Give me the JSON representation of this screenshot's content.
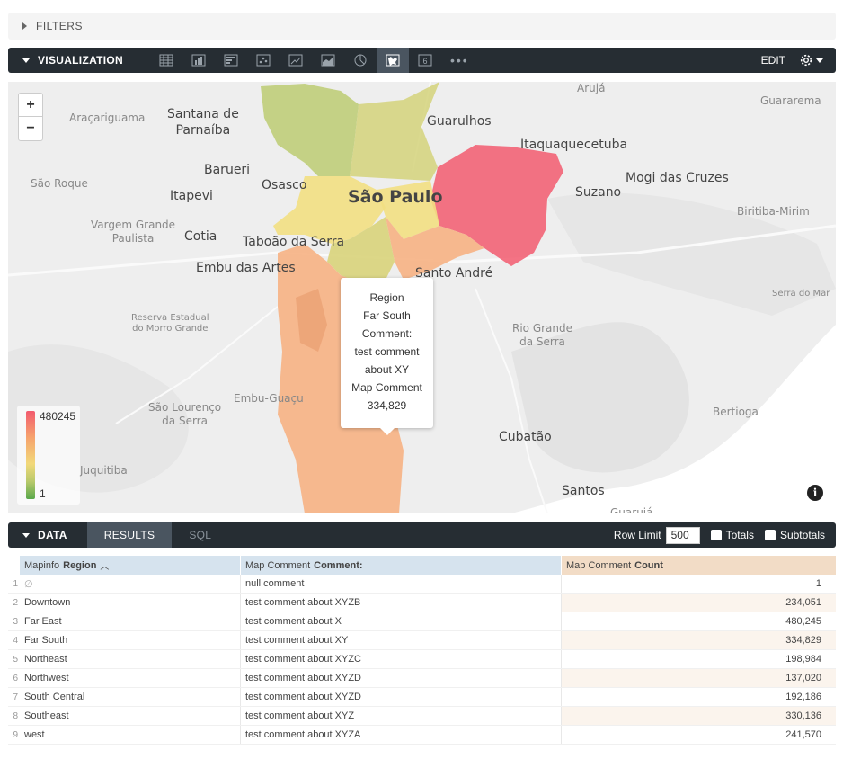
{
  "filters": {
    "label": "FILTERS"
  },
  "visualization": {
    "title": "VISUALIZATION",
    "edit_label": "EDIT",
    "more_label": "•••",
    "icons": [
      "table-icon",
      "column-chart-icon",
      "bar-chart-icon",
      "scatter-icon",
      "line-chart-icon",
      "area-chart-icon",
      "pie-chart-icon",
      "map-icon",
      "single-value-icon"
    ],
    "single_value_glyph": "6"
  },
  "map": {
    "zoom_in": "+",
    "zoom_out": "−",
    "legend_max": "480245",
    "legend_min": "1",
    "info": "i",
    "places": {
      "santana": "Santana de\nParnaíba",
      "guarulhos": "Guarulhos",
      "aruja": "Arujá",
      "guararema": "Guararema",
      "aracariguama": "Araçariguama",
      "itaquaquecetuba": "Itaquaquecetuba",
      "barueri": "Barueri",
      "osasco": "Osasco",
      "saopaulo": "São Paulo",
      "saoroque": "São Roque",
      "itapevi": "Itapevi",
      "suzano": "Suzano",
      "mogi": "Mogi das Cruzes",
      "biritiba": "Biritiba-Mirim",
      "vargem": "Vargem Grande\nPaulista",
      "cotia": "Cotia",
      "taboao": "Taboão da Serra",
      "embuartes": "Embu das Artes",
      "santoandre": "Santo André",
      "serramar": "Serra do Mar",
      "reserva": "Reserva Estadual\ndo Morro Grande",
      "riogrande": "Rio Grande\nda Serra",
      "embuguacu": "Embu-Guaçu",
      "saolourenco": "São Lourenço\nda Serra",
      "bertioga": "Bertioga",
      "cubatao": "Cubatão",
      "juquitiba": "Juquitiba",
      "santos": "Santos",
      "guaruja": "Guarujá"
    },
    "tooltip": [
      "Region",
      "Far South",
      "Comment:",
      "test comment",
      "about XY",
      "Map Comment",
      "334,829"
    ],
    "colors": {
      "high": "#f25b6e",
      "mid": "#f6b183",
      "yellow": "#f2df82",
      "olive": "#d3d27a",
      "green": "#bccb72"
    }
  },
  "data": {
    "title": "DATA",
    "tabs": [
      "RESULTS",
      "SQL"
    ],
    "row_limit_label": "Row Limit",
    "row_limit_value": "500",
    "totals_label": "Totals",
    "subtotals_label": "Subtotals"
  },
  "table": {
    "headers": {
      "region_prefix": "Mapinfo",
      "region_field": "Region",
      "region_sort": "︿",
      "comment_prefix": "Map Comment",
      "comment_field": "Comment:",
      "count_prefix": "Map Comment",
      "count_field": "Count"
    },
    "rows": [
      {
        "n": "1",
        "region": "∅",
        "comment": "null comment",
        "count": "1"
      },
      {
        "n": "2",
        "region": "Downtown",
        "comment": "test comment about XYZB",
        "count": "234,051"
      },
      {
        "n": "3",
        "region": "Far East",
        "comment": "test comment about X",
        "count": "480,245"
      },
      {
        "n": "4",
        "region": "Far South",
        "comment": "test comment about XY",
        "count": "334,829"
      },
      {
        "n": "5",
        "region": "Northeast",
        "comment": "test comment about XYZC",
        "count": "198,984"
      },
      {
        "n": "6",
        "region": "Northwest",
        "comment": "test comment about XYZD",
        "count": "137,020"
      },
      {
        "n": "7",
        "region": "South Central",
        "comment": "test comment about XYZD",
        "count": "192,186"
      },
      {
        "n": "8",
        "region": "Southeast",
        "comment": "test comment about XYZ",
        "count": "330,136"
      },
      {
        "n": "9",
        "region": "west",
        "comment": "test comment about XYZA",
        "count": "241,570"
      }
    ]
  }
}
